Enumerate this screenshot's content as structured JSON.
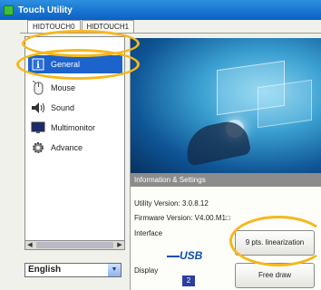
{
  "window": {
    "title": "Touch Utility"
  },
  "tabs": [
    {
      "label": "HIDTOUCH0",
      "active": true
    },
    {
      "label": "HIDTOUCH1",
      "active": false
    }
  ],
  "sidebar": {
    "items": [
      {
        "label": "General",
        "icon": "info-icon",
        "selected": true
      },
      {
        "label": "Mouse",
        "icon": "mouse-icon",
        "selected": false
      },
      {
        "label": "Sound",
        "icon": "speaker-icon",
        "selected": false
      },
      {
        "label": "Multimonitor",
        "icon": "monitor-icon",
        "selected": false
      },
      {
        "label": "Advance",
        "icon": "gear-icon",
        "selected": false
      }
    ]
  },
  "language": {
    "selected": "English"
  },
  "info": {
    "header": "Information & Settings",
    "utility_version": "Utility Version: 3.0.8.12",
    "firmware_version": "Firmware Version: V4.00.M1□",
    "interface_label": "Interface",
    "interface_value": "USB",
    "display_label": "Display",
    "display_value": "2"
  },
  "buttons": {
    "linearization": "9 pts. linearization",
    "free_draw": "Free draw"
  },
  "colors": {
    "titlebar": "#0b60c4",
    "selection": "#1c63cc",
    "highlight": "#f6b81a"
  }
}
